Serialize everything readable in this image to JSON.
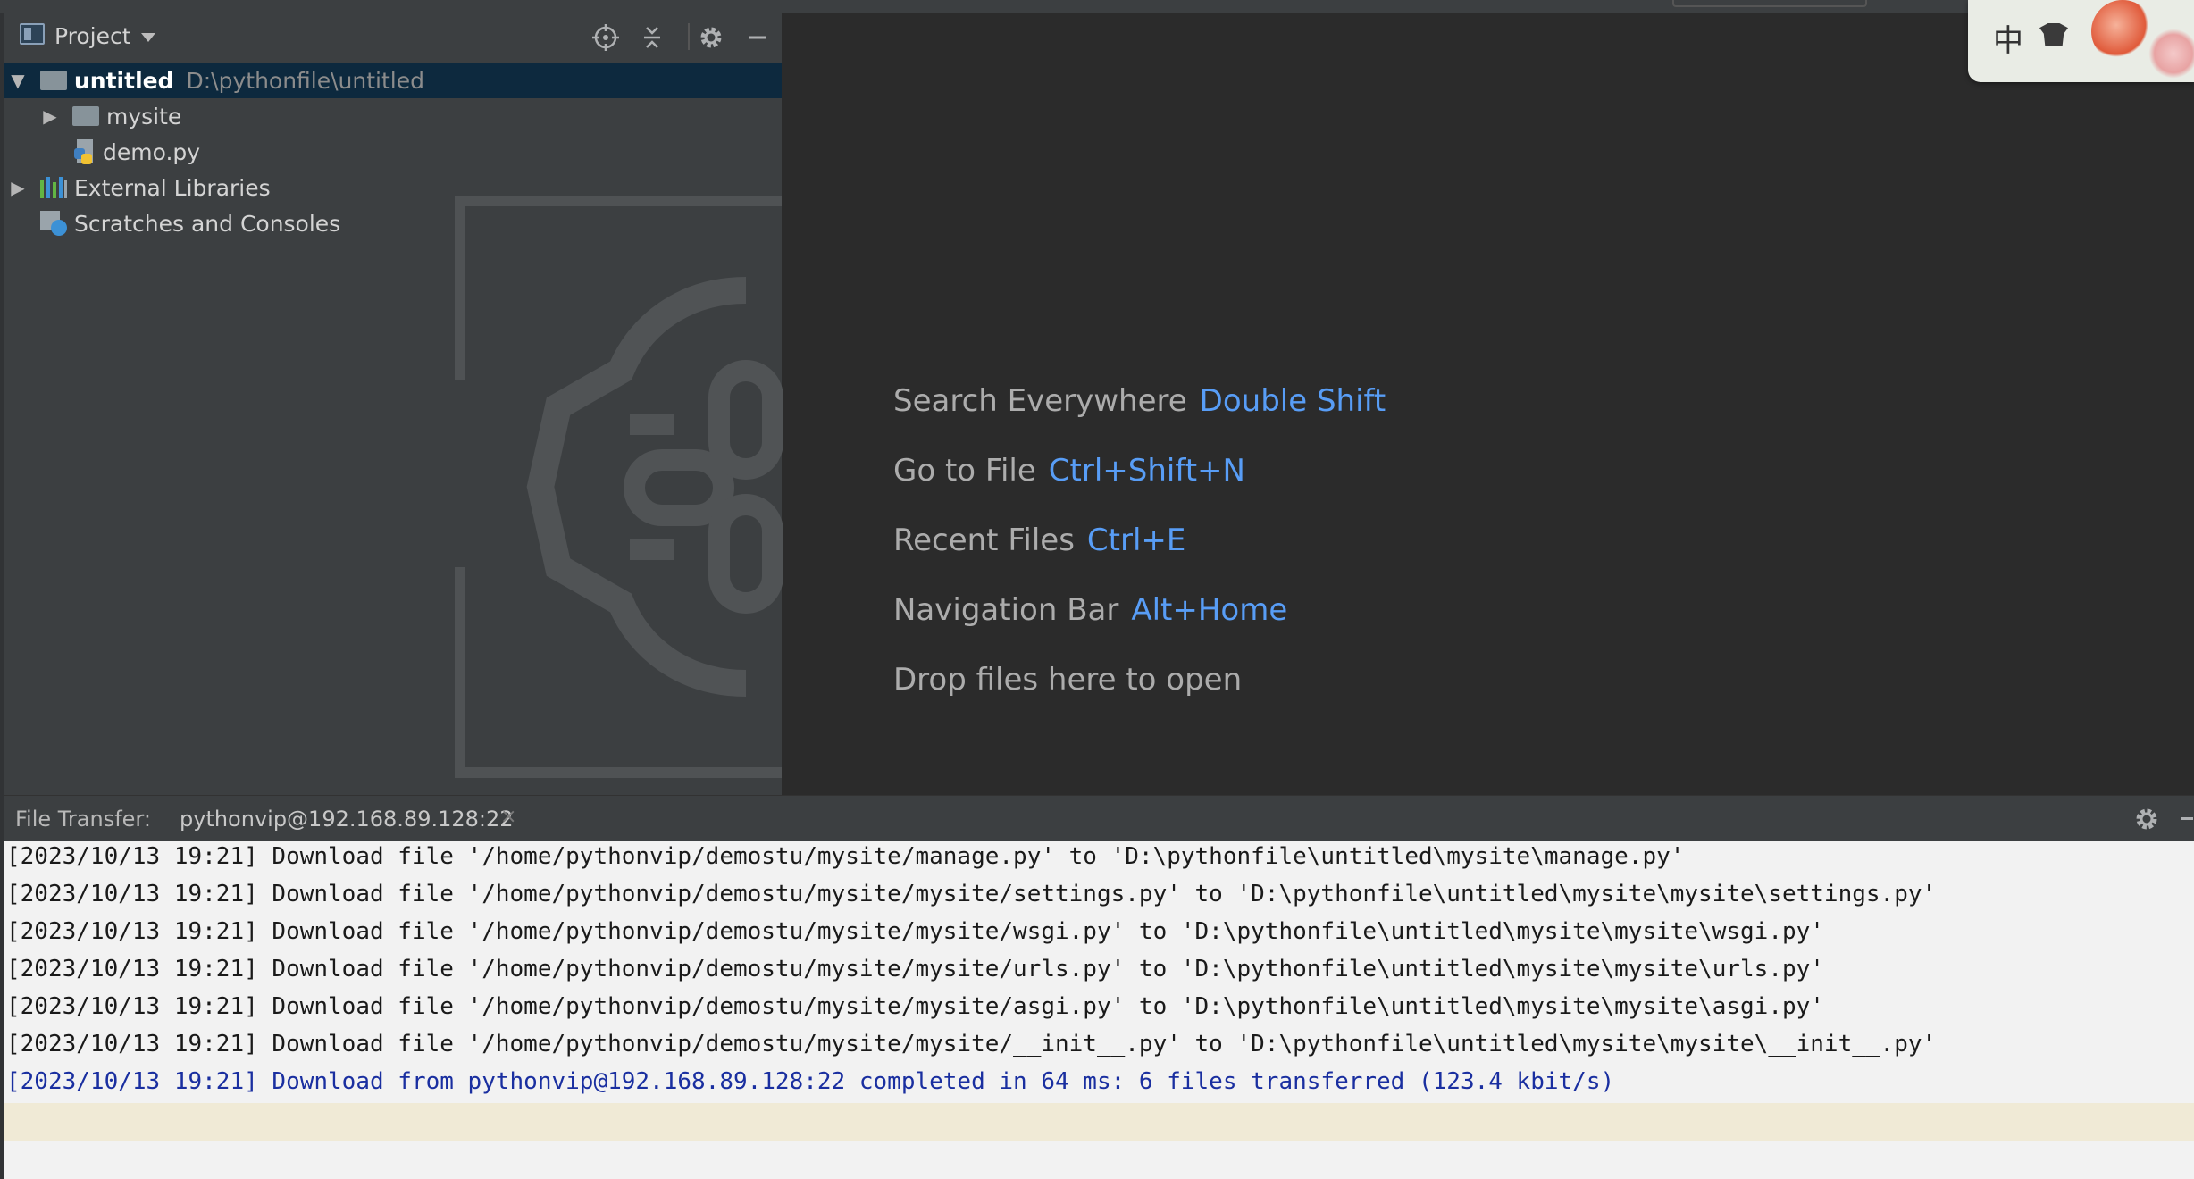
{
  "project_panel": {
    "title": "Project",
    "tree": [
      {
        "label": "untitled",
        "hint": "D:\\pythonfile\\untitled",
        "expanded": true,
        "selected": true
      },
      {
        "label": "mysite"
      },
      {
        "label": "demo.py"
      },
      {
        "label": "External Libraries"
      },
      {
        "label": "Scratches and Consoles"
      }
    ]
  },
  "editor": {
    "hints": [
      {
        "action": "Search Everywhere",
        "shortcut": "Double Shift"
      },
      {
        "action": "Go to File",
        "shortcut": "Ctrl+Shift+N"
      },
      {
        "action": "Recent Files",
        "shortcut": "Ctrl+E"
      },
      {
        "action": "Navigation Bar",
        "shortcut": "Alt+Home"
      },
      {
        "action": "Drop files here to open",
        "shortcut": ""
      }
    ]
  },
  "ime": {
    "mode_label": "中"
  },
  "file_transfer": {
    "label": "File Transfer:",
    "tab": "pythonvip@192.168.89.128:22",
    "log": [
      "[2023/10/13 19:21] Download file '/home/pythonvip/demostu/mysite/manage.py' to 'D:\\pythonfile\\untitled\\mysite\\manage.py'",
      "[2023/10/13 19:21] Download file '/home/pythonvip/demostu/mysite/mysite/settings.py' to 'D:\\pythonfile\\untitled\\mysite\\mysite\\settings.py'",
      "[2023/10/13 19:21] Download file '/home/pythonvip/demostu/mysite/mysite/wsgi.py' to 'D:\\pythonfile\\untitled\\mysite\\mysite\\wsgi.py'",
      "[2023/10/13 19:21] Download file '/home/pythonvip/demostu/mysite/mysite/urls.py' to 'D:\\pythonfile\\untitled\\mysite\\mysite\\urls.py'",
      "[2023/10/13 19:21] Download file '/home/pythonvip/demostu/mysite/mysite/asgi.py' to 'D:\\pythonfile\\untitled\\mysite\\mysite\\asgi.py'",
      "[2023/10/13 19:21] Download file '/home/pythonvip/demostu/mysite/mysite/__init__.py' to 'D:\\pythonfile\\untitled\\mysite\\mysite\\__init__.py'",
      "[2023/10/13 19:21] Download from pythonvip@192.168.89.128:22 completed in 64 ms: 6 files transferred (123.4 kbit/s)"
    ]
  },
  "colors": {
    "accent": "#589df6",
    "selection": "#0d293e",
    "log_summary": "#1a2fa0"
  }
}
